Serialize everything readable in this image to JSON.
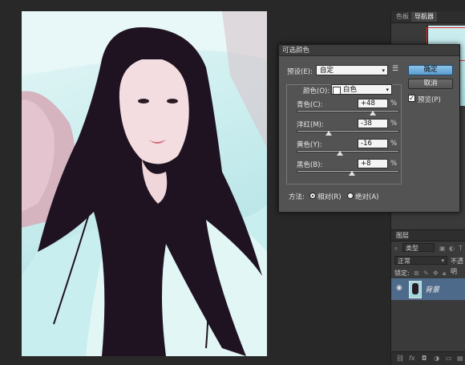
{
  "right_panel": {
    "tabs": [
      "色板",
      "导航器"
    ],
    "layers_title": "图层",
    "kind_label": "类型",
    "blend_mode": "正常",
    "opacity_label": "不透明",
    "lock_label": "锁定:",
    "layer_name": "背景",
    "footer_fx": "fx"
  },
  "dialog": {
    "title": "可选颜色",
    "preset_label": "预设(E):",
    "preset_value": "自定",
    "colors_label": "颜色(O):",
    "colors_value": "白色",
    "ok_label": "确定",
    "cancel_label": "取消",
    "preview_label": "预览(P)",
    "preview_checked": true,
    "sliders": [
      {
        "label": "青色(C):",
        "value": "+48",
        "unit": "%",
        "level": 0.74
      },
      {
        "label": "洋红(M):",
        "value": "-38",
        "unit": "%",
        "level": 0.31
      },
      {
        "label": "黄色(Y):",
        "value": "-16",
        "unit": "%",
        "level": 0.42
      },
      {
        "label": "黑色(B):",
        "value": "+8",
        "unit": "%",
        "level": 0.54
      }
    ],
    "method_label": "方法:",
    "method_relative": "相对(R)",
    "method_absolute": "绝对(A)",
    "method_selected": "relative"
  }
}
